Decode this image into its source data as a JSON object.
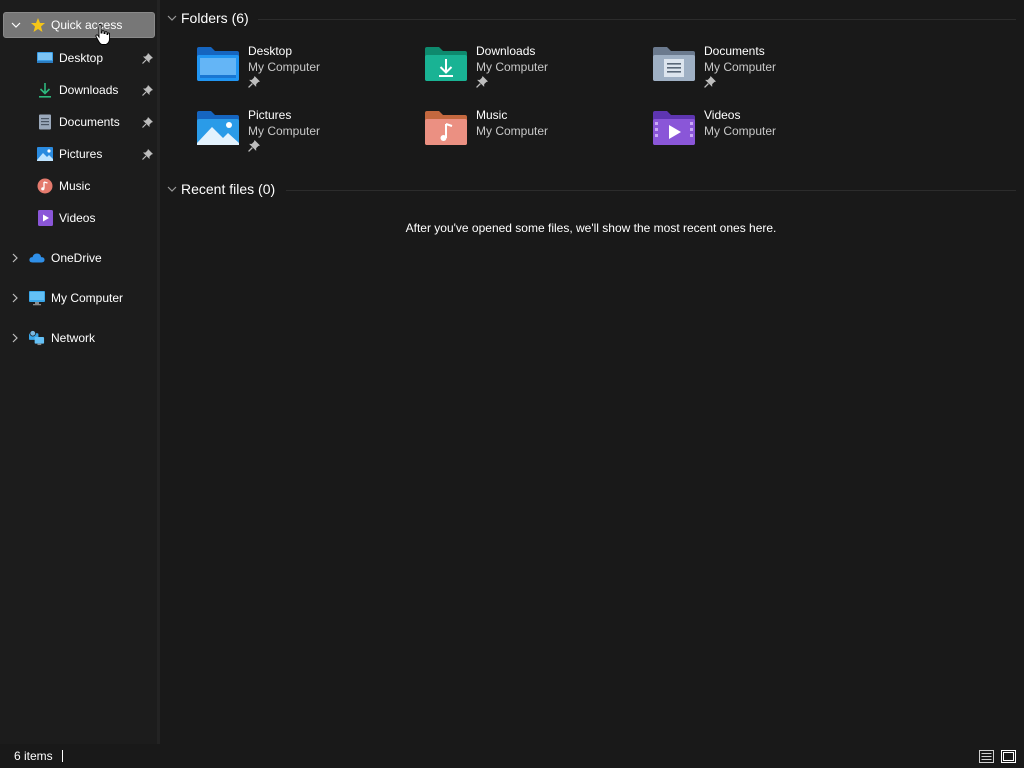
{
  "sidebar": {
    "quick_access": {
      "label": "Quick access",
      "icon": "star-icon",
      "color": "#f5c518"
    },
    "pinned": [
      {
        "label": "Desktop",
        "icon": "desktop-icon",
        "pinned": true
      },
      {
        "label": "Downloads",
        "icon": "downloads-icon",
        "pinned": true
      },
      {
        "label": "Documents",
        "icon": "documents-icon",
        "pinned": true
      },
      {
        "label": "Pictures",
        "icon": "pictures-icon",
        "pinned": true
      },
      {
        "label": "Music",
        "icon": "music-icon",
        "pinned": false
      },
      {
        "label": "Videos",
        "icon": "videos-icon",
        "pinned": false
      }
    ],
    "roots": [
      {
        "label": "OneDrive",
        "icon": "onedrive-icon"
      },
      {
        "label": "My Computer",
        "icon": "computer-icon"
      },
      {
        "label": "Network",
        "icon": "network-icon"
      }
    ]
  },
  "main": {
    "folders_heading": "Folders (6)",
    "folders": [
      {
        "name": "Desktop",
        "location": "My Computer",
        "pinned": true,
        "icon": "desktop-folder-icon",
        "color": "#1e8fe0"
      },
      {
        "name": "Downloads",
        "location": "My Computer",
        "pinned": true,
        "icon": "downloads-folder-icon",
        "color": "#1aa88c"
      },
      {
        "name": "Documents",
        "location": "My Computer",
        "pinned": true,
        "icon": "documents-folder-icon",
        "color": "#8a9bb0"
      },
      {
        "name": "Pictures",
        "location": "My Computer",
        "pinned": true,
        "icon": "pictures-folder-icon",
        "color": "#2a9be8"
      },
      {
        "name": "Music",
        "location": "My Computer",
        "pinned": false,
        "icon": "music-folder-icon",
        "color": "#e8876a"
      },
      {
        "name": "Videos",
        "location": "My Computer",
        "pinned": false,
        "icon": "videos-folder-icon",
        "color": "#8a56d8"
      }
    ],
    "recent_heading": "Recent files (0)",
    "recent_empty": "After you've opened some files, we'll show the most recent ones here."
  },
  "statusbar": {
    "item_count": "6 items",
    "views": [
      "details-view-icon",
      "large-icons-view-icon"
    ]
  }
}
